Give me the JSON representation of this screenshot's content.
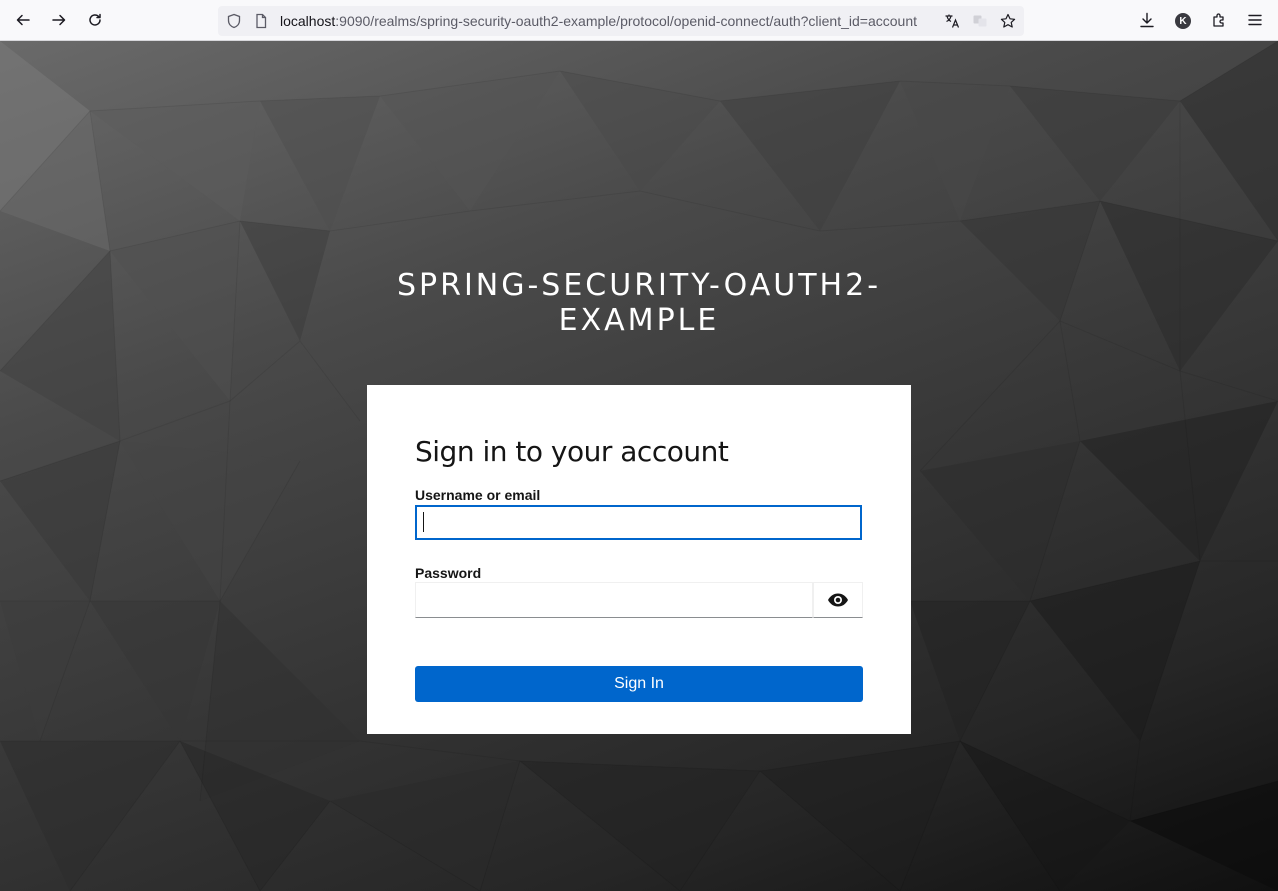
{
  "browser": {
    "url_host": "localhost",
    "url_rest": ":9090/realms/spring-security-oauth2-example/protocol/openid-connect/auth?client_id=account",
    "profile_initial": "K"
  },
  "realm": {
    "title_line1": "SPRING-SECURITY-OAUTH2-",
    "title_line2": "EXAMPLE"
  },
  "login": {
    "heading": "Sign in to your account",
    "username_label": "Username or email",
    "username_value": "",
    "password_label": "Password",
    "password_value": "",
    "submit_label": "Sign In"
  },
  "colors": {
    "accent": "#0066cc",
    "card_bg": "#ffffff"
  }
}
